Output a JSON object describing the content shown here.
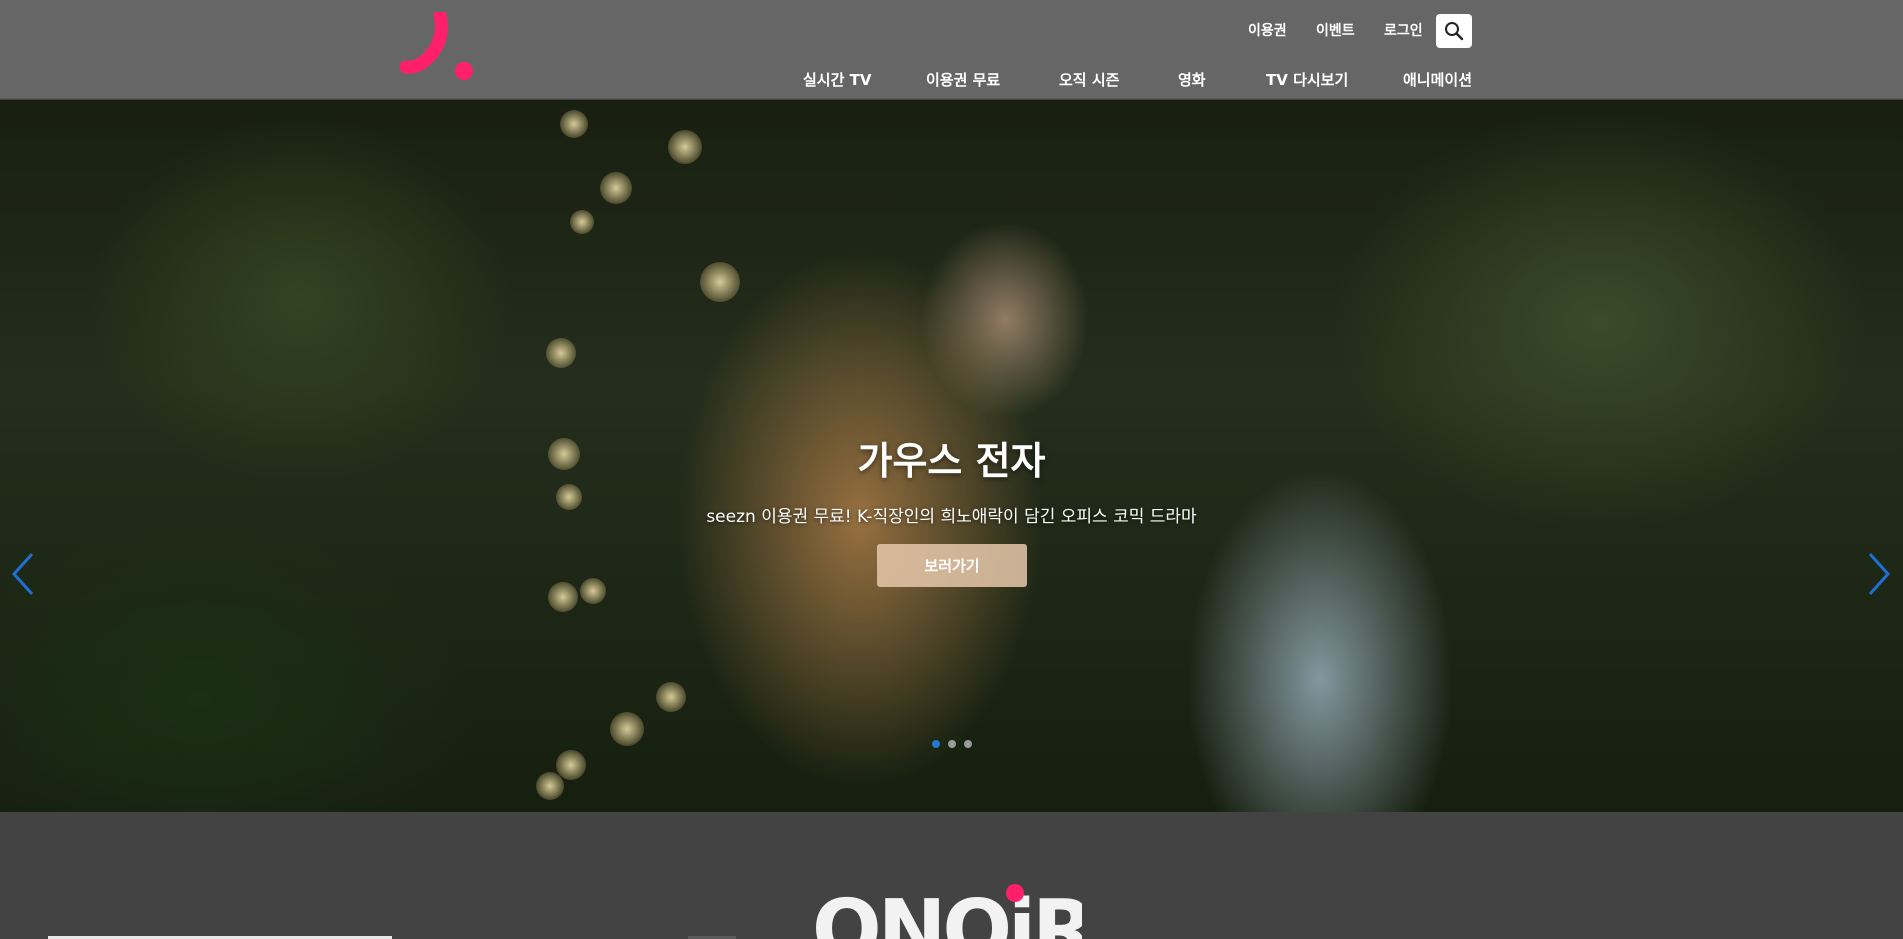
{
  "header": {
    "util_links": [
      "이용권",
      "이벤트",
      "로그인"
    ],
    "nav": [
      "실시간 TV",
      "이용권 무료",
      "오직 시즌",
      "영화",
      "TV 다시보기",
      "애니메이션"
    ],
    "brand_color": "#ff1f6b"
  },
  "hero": {
    "title": "가우스 전자",
    "subtitle": "seezn 이용권 무료! K-직장인의 희노애락이 담긴 오피스 코믹 드라마",
    "button_label": "보러가기",
    "slide_count": 3,
    "active_slide": 1,
    "arrow_color": "#1e6fd6"
  },
  "section": {
    "logo_text": "ONQiR"
  }
}
